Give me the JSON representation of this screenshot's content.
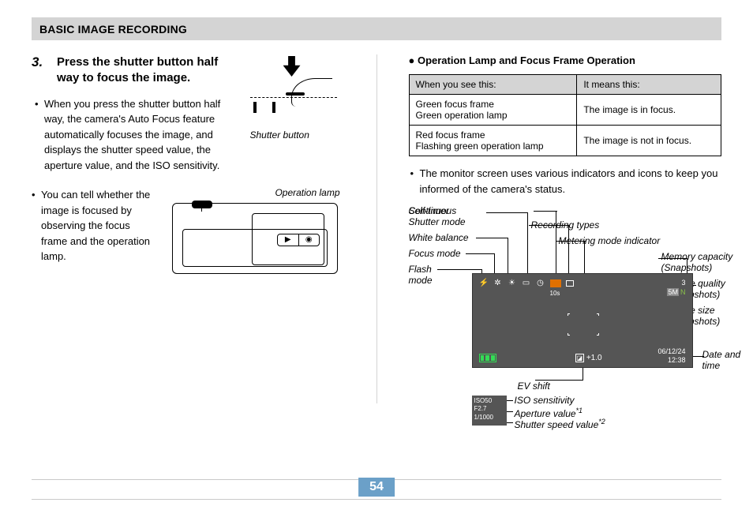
{
  "header": {
    "section_title": "BASIC IMAGE RECORDING"
  },
  "left": {
    "step_number": "3.",
    "step_title": "Press the shutter button half way to focus the image.",
    "bullets": [
      "When you press the shutter button half way, the camera's Auto Focus feature automatically focuses the image, and displays the shutter speed value, the aperture value, and the ISO sensitivity.",
      "You can tell whether the image is focused by observing the focus frame and the operation lamp."
    ],
    "fig1_label": "Shutter button",
    "fig2_label": "Operation lamp"
  },
  "right": {
    "heading": "Operation Lamp and Focus Frame Operation",
    "table": {
      "col1": "When you see this:",
      "col2": "It means this:",
      "rows": [
        {
          "see1": "Green focus frame",
          "see2": "Green operation lamp",
          "means": "The image is in focus."
        },
        {
          "see1": "Red focus frame",
          "see2": "Flashing green operation lamp",
          "means": "The image is not in focus."
        }
      ]
    },
    "bullet": "The monitor screen uses various indicators and icons to keep you informed of the camera's status.",
    "labels": {
      "continuous_shutter": "Continuous Shutter mode",
      "white_balance": "White balance",
      "focus_mode": "Focus mode",
      "flash_mode": "Flash mode",
      "self_timer": "Self-timer",
      "recording_types": "Recording types",
      "metering_mode": "Metering mode indicator",
      "memory_capacity": "Memory capacity (Snapshots)",
      "image_quality": "Image quality (Snapshots)",
      "image_size": "Image size (Snapshots)",
      "date_time": "Date and time",
      "ev_shift": "EV shift",
      "iso": "ISO sensitivity",
      "aperture": "Aperture value",
      "shutter_speed": "Shutter speed value",
      "star1": "*1",
      "star2": "*2"
    },
    "monitor": {
      "tens": "10s",
      "count": "3",
      "size": "5M",
      "n": "N",
      "ev": "+1.0",
      "date": "06/12/24",
      "time": "12:38",
      "panel_iso": "ISO50",
      "panel_f": "F2.7",
      "panel_shutter": "1/1000"
    }
  },
  "page_number": "54"
}
